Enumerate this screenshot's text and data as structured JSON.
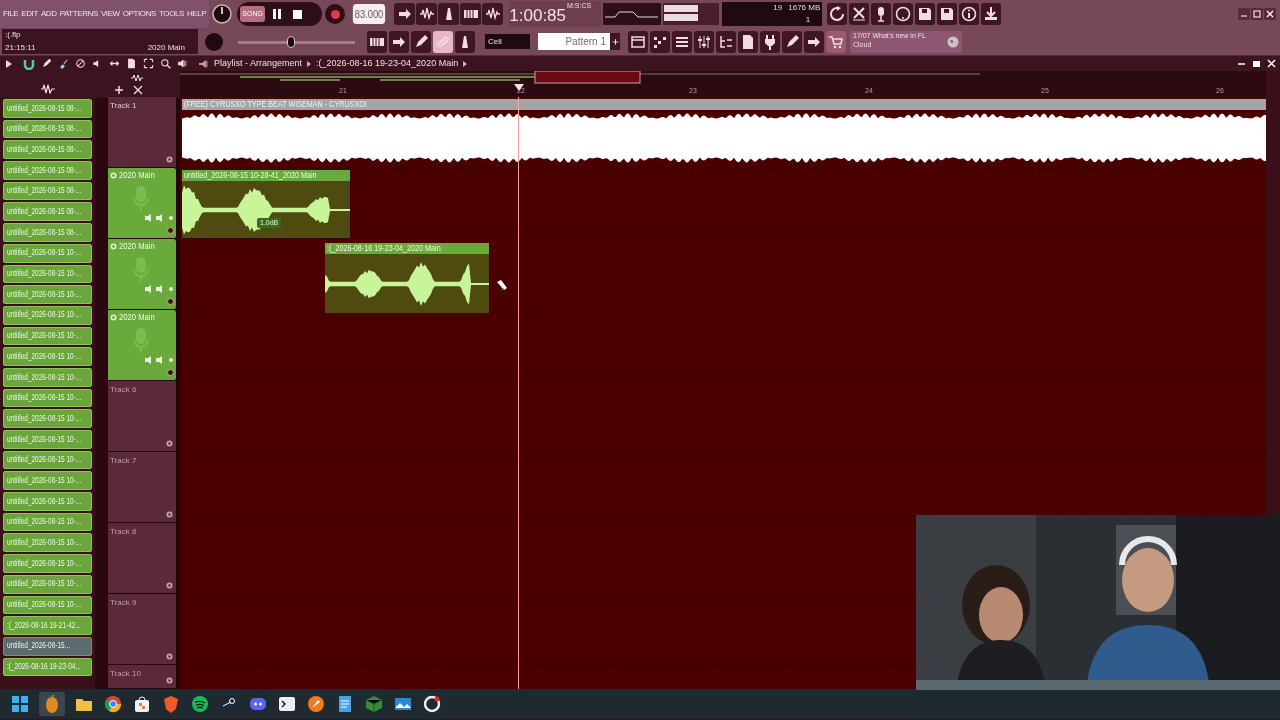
{
  "menu": [
    {
      "label": "FILE"
    },
    {
      "label": "EDIT"
    },
    {
      "label": "ADD"
    },
    {
      "label": "PATTERNS"
    },
    {
      "label": "VIEW"
    },
    {
      "label": "OPTIONS"
    },
    {
      "label": "TOOLS"
    },
    {
      "label": "HELP"
    }
  ],
  "hint_panel": {
    "file": ":(.flp",
    "clock": "21:15:11",
    "channel": "2020 Main"
  },
  "transport": {
    "mode_label": "SONG",
    "playing": false,
    "recording": true,
    "tempo": "83.000",
    "time": "1:00:85",
    "time_unit": "M:S:CS"
  },
  "master_pitch": {
    "level": 0.45
  },
  "monitor": {
    "cpu": "19",
    "memory": "1676 MB",
    "polyphony": "1"
  },
  "snap": "Cell",
  "pattern": "Pattern 1",
  "news": {
    "date": "17/07",
    "text": "What's new in FL Cloud"
  },
  "browser": {
    "items": [
      {
        "label": "untitled_2026-08-15 08-...",
        "selected": false
      },
      {
        "label": "untitled_2026-08-15 08-...",
        "selected": false
      },
      {
        "label": "untitled_2026-08-15 08-...",
        "selected": false
      },
      {
        "label": "untitled_2026-08-15 08-...",
        "selected": false
      },
      {
        "label": "untitled_2026-08-15 08-...",
        "selected": false
      },
      {
        "label": "untitled_2026-08-15 08-...",
        "selected": false
      },
      {
        "label": "untitled_2026-08-15 08-...",
        "selected": false
      },
      {
        "label": "untitled_2026-08-15 10-...",
        "selected": false
      },
      {
        "label": "untitled_2026-08-15 10-...",
        "selected": false
      },
      {
        "label": "untitled_2026-08-15 10-...",
        "selected": false
      },
      {
        "label": "untitled_2026-08-15 10-...",
        "selected": false
      },
      {
        "label": "untitled_2026-08-15 10-...",
        "selected": false
      },
      {
        "label": "untitled_2026-08-15 10-...",
        "selected": false
      },
      {
        "label": "untitled_2026-08-15 10-...",
        "selected": false
      },
      {
        "label": "untitled_2026-08-15 10-...",
        "selected": false
      },
      {
        "label": "untitled_2026-08-15 10-...",
        "selected": false
      },
      {
        "label": "untitled_2026-08-15 10-...",
        "selected": false
      },
      {
        "label": "untitled_2026-08-15 10-...",
        "selected": false
      },
      {
        "label": "untitled_2026-08-15 10-...",
        "selected": false
      },
      {
        "label": "untitled_2026-08-15 10-...",
        "selected": false
      },
      {
        "label": "untitled_2026-08-15 10-...",
        "selected": false
      },
      {
        "label": "untitled_2026-08-15 10-...",
        "selected": false
      },
      {
        "label": "untitled_2026-08-15 10-...",
        "selected": false
      },
      {
        "label": "untitled_2026-08-15 10-...",
        "selected": false
      },
      {
        "label": "untitled_2026-08-15 10-...",
        "selected": false
      },
      {
        "label": ":(_2026-08-16 19-21-42...",
        "selected": false
      },
      {
        "label": "untitled_2026-08-15...",
        "selected": true
      },
      {
        "label": ":(_2026-08-16 19-23-04...",
        "selected": false
      }
    ]
  },
  "playlist": {
    "title": "Playlist - Arrangement",
    "breadcrumb": ":(_2026-08-16 19-23-04_2020 Main",
    "ruler": [
      "21",
      "22",
      "23",
      "24",
      "25",
      "26"
    ],
    "tracks": [
      {
        "name": "Track 1",
        "kind": "plain"
      },
      {
        "name": "2020 Main",
        "kind": "audio"
      },
      {
        "name": "2020 Main",
        "kind": "audio"
      },
      {
        "name": "2020 Main",
        "kind": "audio"
      },
      {
        "name": "Track 6",
        "kind": "plain"
      },
      {
        "name": "Track 7",
        "kind": "plain"
      },
      {
        "name": "Track 8",
        "kind": "plain"
      },
      {
        "name": "Track 9",
        "kind": "plain"
      },
      {
        "name": "Track 10",
        "kind": "plain"
      }
    ],
    "clips": [
      {
        "title": "(FREE) CYRUSXO TYPE BEAT WISEMAN - CYRUSXO!",
        "kind": "beat"
      },
      {
        "title": "untitled_2026-08-15 10-28-41_2020 Main",
        "kind": "vocal",
        "gain": "1.0dB"
      },
      {
        "title": ":(_2026-08-16 19-23-04_2020 Main",
        "kind": "vocal"
      }
    ]
  }
}
